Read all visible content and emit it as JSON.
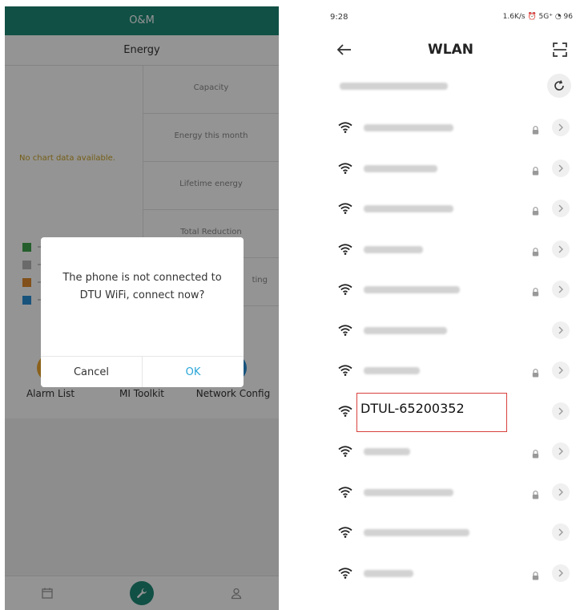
{
  "left_screen": {
    "header_title": "O&M",
    "energy_tab": "Energy",
    "no_chart_text": "No chart data available.",
    "stats": [
      "Capacity",
      "Energy this month",
      "Lifetime energy",
      "Total Reduction",
      "ting"
    ],
    "legend_colors": [
      "#3fa34d",
      "#b7b7b7",
      "#e08a2e",
      "#2a8fd6"
    ],
    "tools": [
      "Alarm List",
      "MI Toolkit",
      "Network Config"
    ],
    "dialog": {
      "message": "The phone is not connected to DTU WiFi, connect now?",
      "cancel_label": "Cancel",
      "ok_label": "OK"
    },
    "nav": [
      "calendar-icon",
      "wrench-icon",
      "user-icon"
    ],
    "accent_color": "#1e8a78"
  },
  "right_screen": {
    "status_time": "9:28",
    "status_right": "1.6K/s ⏰ 5G⁺ ◔ 96",
    "title": "WLAN",
    "networks": [
      {
        "locked": true
      },
      {
        "locked": true
      },
      {
        "locked": true
      },
      {
        "locked": true
      },
      {
        "locked": true
      },
      {
        "locked": false
      },
      {
        "locked": true
      },
      {
        "name": "DTUL-65200352",
        "locked": false,
        "highlighted": true
      },
      {
        "locked": true
      },
      {
        "locked": true
      },
      {
        "locked": false
      },
      {
        "locked": true
      }
    ],
    "highlight_color": "#d9413e"
  }
}
